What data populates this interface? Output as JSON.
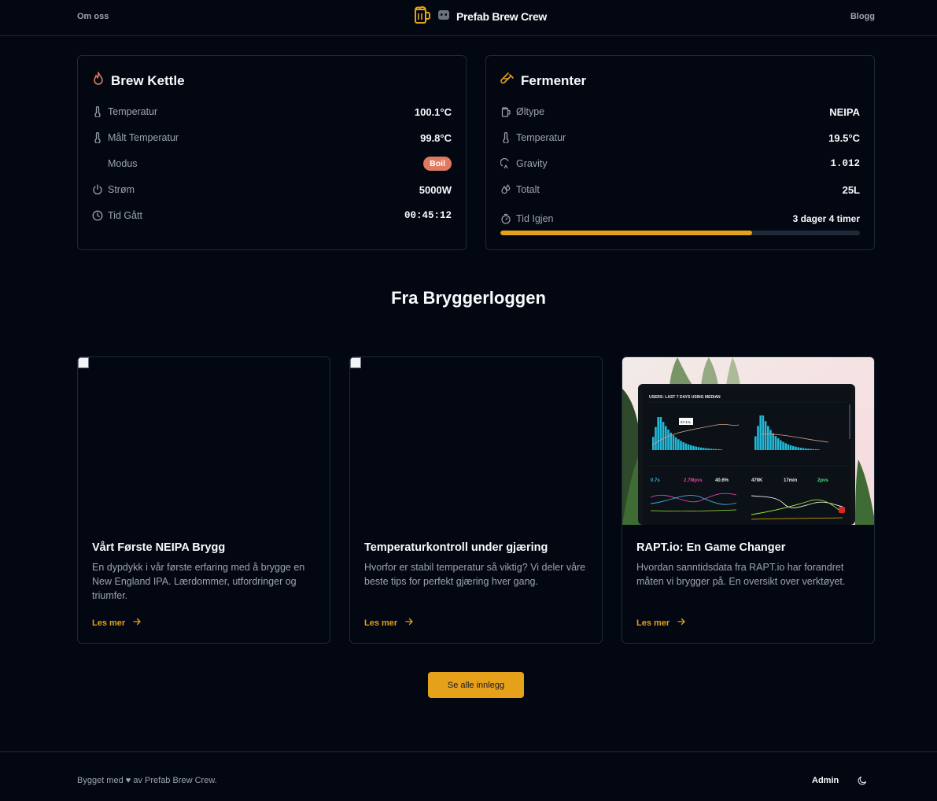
{
  "nav": {
    "left": "Om oss",
    "right": "Blogg",
    "brand": "Prefab Brew Crew"
  },
  "kettle": {
    "title": "Brew Kettle",
    "rows": [
      {
        "icon": "thermometer-icon",
        "label": "Temperatur",
        "value": "100.1°C"
      },
      {
        "icon": "thermometer-icon",
        "label": "Målt Temperatur",
        "value": "99.8°C"
      },
      {
        "icon": "",
        "label": "Modus",
        "value": "Boil"
      },
      {
        "icon": "power-icon",
        "label": "Strøm",
        "value": "5000W"
      },
      {
        "icon": "clock-icon",
        "label": "Tid Gått",
        "value": "00:45:12"
      }
    ]
  },
  "fermenter": {
    "title": "Fermenter",
    "rows": [
      {
        "icon": "beer-icon",
        "label": "Øltype",
        "value": "NEIPA"
      },
      {
        "icon": "thermometer-icon",
        "label": "Temperatur",
        "value": "19.5°C"
      },
      {
        "icon": "gravity-icon",
        "label": "Gravity",
        "value": "1.012"
      },
      {
        "icon": "droplets-icon",
        "label": "Totalt",
        "value": "25L"
      },
      {
        "icon": "timer-icon",
        "label": "Tid Igjen",
        "value": "3 dager 4 timer"
      }
    ],
    "progress": 0.7
  },
  "blog": {
    "section_title": "Fra Bryggerloggen",
    "posts": [
      {
        "title": "Vårt Første NEIPA Brygg",
        "desc": "En dypdykk i vår første erfaring med å brygge en New England IPA. Lærdommer, utfordringer og triumfer.",
        "link": "Les mer"
      },
      {
        "title": "Temperaturkontroll under gjæring",
        "desc": "Hvorfor er stabil temperatur så viktig? Vi deler våre beste tips for perfekt gjæring hver gang.",
        "link": "Les mer"
      },
      {
        "title": "RAPT.io: En Game Changer",
        "desc": "Hvordan sanntidsdata fra RAPT.io har forandret måten vi brygger på. En oversikt over verktøyet.",
        "link": "Les mer"
      }
    ],
    "see_all": "Se alle innlegg"
  },
  "dashboard_image": {
    "header": "USERS: LAST 7 DAYS USING MEDIAN",
    "stats_left": [
      "0.7s",
      "2.7Mpvs",
      "40.6%"
    ],
    "stats_right": [
      "479K",
      "17min",
      "2pvs"
    ],
    "tooltip": "57.1%"
  },
  "footer": {
    "text": "Bygget med ♥ av Prefab Brew Crew.",
    "admin": "Admin"
  },
  "colors": {
    "accent": "#e5a11a",
    "badge": "#e07a5f",
    "background": "#030712",
    "border": "#1f2937"
  }
}
